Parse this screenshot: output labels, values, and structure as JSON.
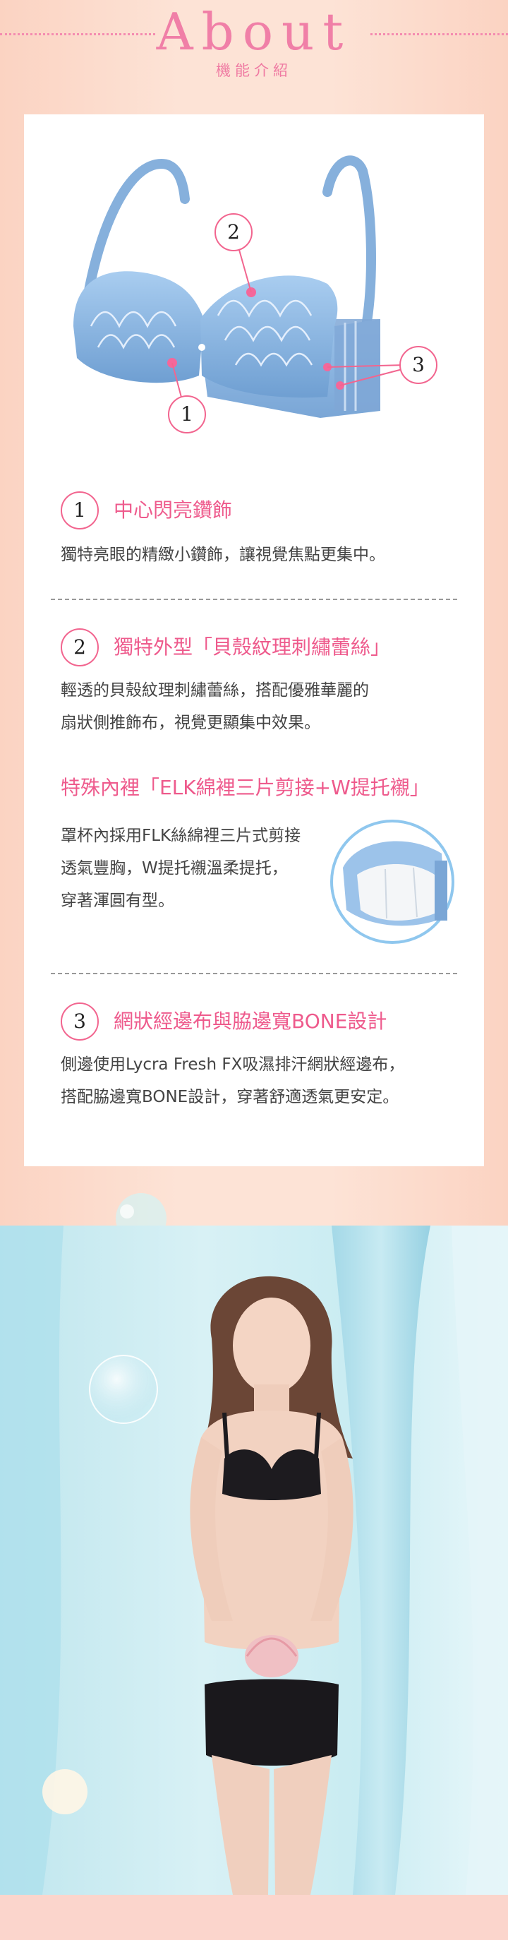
{
  "header": {
    "title": "About",
    "subtitle": "機能介紹"
  },
  "diagram": {
    "callouts": [
      "2",
      "3",
      "1"
    ]
  },
  "features": [
    {
      "number": "1",
      "title": "中心閃亮鑽飾",
      "lines": [
        "獨特亮眼的精緻小鑽飾，讓視覺焦點更集中。"
      ]
    },
    {
      "number": "2",
      "title": "獨特外型「貝殼紋理刺繡蕾絲」",
      "lines": [
        "輕透的貝殼紋理刺繡蕾絲，搭配優雅華麗的",
        "扇狀側推飾布，視覺更顯集中效果。"
      ]
    },
    {
      "number": "3",
      "title": "網狀經邊布與脇邊寬BONE設計",
      "lines": [
        "側邊使用Lycra Fresh FX吸濕排汗網狀經邊布，",
        "搭配脇邊寬BONE設計，穿著舒適透氣更安定。"
      ]
    }
  ],
  "lining": {
    "title": "特殊內裡「ELK綿裡三片剪接+W提托襯」",
    "lines": [
      "罩杯內採用FLK絲綿裡三片式剪接",
      "透氣豐胸，W提托襯溫柔提托，",
      "穿著渾圓有型。"
    ]
  },
  "colors": {
    "accent": "#ee5a8c",
    "bra_blue": "#8fb8e2",
    "background_peach": "#fde3d6",
    "photo_aqua": "#c9ecf2"
  }
}
